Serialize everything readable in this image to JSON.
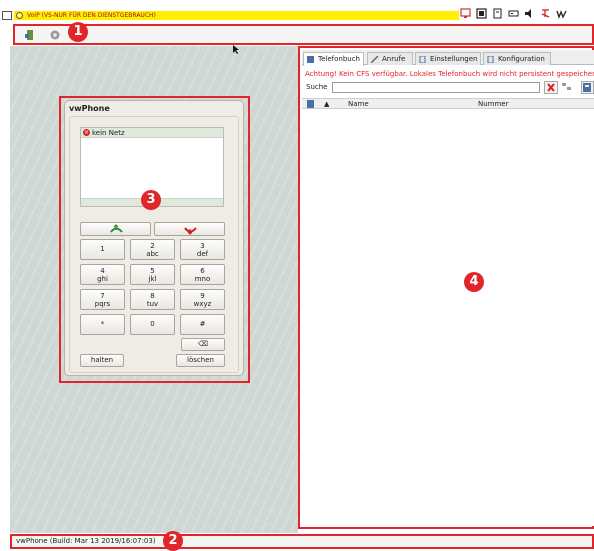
{
  "titlebar": {
    "title": "VoIP (VS-NUR FÜR DEN DIENSTGEBRAUCH)"
  },
  "annotations": {
    "n1": "1",
    "n2": "2",
    "n3": "3",
    "n4": "4"
  },
  "phone": {
    "title": "vwPhone",
    "status": "kein Netz",
    "keys": [
      {
        "digit": "1",
        "letters": ""
      },
      {
        "digit": "2",
        "letters": "abc"
      },
      {
        "digit": "3",
        "letters": "def"
      },
      {
        "digit": "4",
        "letters": "ghi"
      },
      {
        "digit": "5",
        "letters": "jkl"
      },
      {
        "digit": "6",
        "letters": "mno"
      },
      {
        "digit": "7",
        "letters": "pqrs"
      },
      {
        "digit": "8",
        "letters": "tuv"
      },
      {
        "digit": "9",
        "letters": "wxyz"
      },
      {
        "digit": "*",
        "letters": ""
      },
      {
        "digit": "0",
        "letters": ""
      },
      {
        "digit": "#",
        "letters": ""
      }
    ],
    "backspace": "⌫",
    "hold_label": "halten",
    "delete_label": "löschen"
  },
  "panel": {
    "tabs": [
      {
        "label": "Telefonbuch",
        "active": true
      },
      {
        "label": "Anrufe",
        "active": false
      },
      {
        "label": "Einstellungen",
        "active": false
      },
      {
        "label": "Konfiguration",
        "active": false
      }
    ],
    "warning": "Achtung! Kein CFS verfügbar. Lokales Telefonbuch wird nicht persistent gespeichert.",
    "search_label": "Suche",
    "search_value": "",
    "columns": {
      "sort": "▲",
      "name": "Name",
      "number": "Nummer"
    },
    "rows": []
  },
  "statusbar": {
    "text": "vwPhone  (Build: Mar 13 2019/16:07:03)"
  },
  "colors": {
    "highlight": "#e0262a",
    "warning": "#e4232a",
    "titlebar": "#ffef00"
  }
}
